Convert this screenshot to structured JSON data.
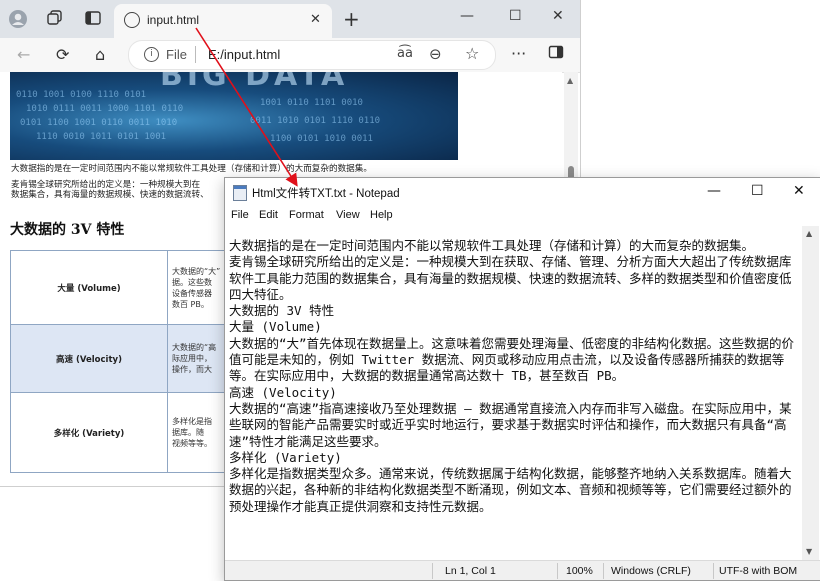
{
  "browser": {
    "tab_title": "input.html",
    "omnibox": {
      "scheme_label": "File",
      "url": "E:/input.html"
    }
  },
  "webpage": {
    "intro": "大数据指的是在一定时间范围内不能以常规软件工具处理（存储和计算）的大而复杂的数据集。",
    "def_line1": "麦肯锡全球研究所给出的定义是：一种规模大到在",
    "def_line2": "数据集合，具有海量的数据规模、快速的数据流转、",
    "section_title": "大数据的 3V 特性",
    "rows": [
      {
        "key": "大量 (Volume)",
        "lines": [
          "大数据的“大”",
          "据。这些数",
          "设备传感器",
          "数百 PB。"
        ]
      },
      {
        "key": "高速 (Velocity)",
        "lines": [
          "大数据的“高",
          "际应用中，",
          "操作，而大"
        ]
      },
      {
        "key": "多样化 (Variety)",
        "lines": [
          "多样化是指",
          "据库。随",
          "视频等等。"
        ]
      }
    ]
  },
  "notepad": {
    "title": "Html文件转TXT.txt - Notepad",
    "menu": [
      "File",
      "Edit",
      "Format",
      "View",
      "Help"
    ],
    "text": "大数据指的是在一定时间范围内不能以常规软件工具处理（存储和计算）的大而复杂的数据集。\n麦肯锡全球研究所给出的定义是：一种规模大到在获取、存储、管理、分析方面大大超出了传统数据库软件工具能力范围的数据集合，具有海量的数据规模、快速的数据流转、多样的数据类型和价值密度低四大特征。\n大数据的 3V 特性\n大量 (Volume)\n大数据的“大”首先体现在数据量上。这意味着您需要处理海量、低密度的非结构化数据。这些数据的价值可能是未知的，例如 Twitter 数据流、网页或移动应用点击流，以及设备传感器所捕获的数据等等。在实际应用中，大数据的数据量通常高达数十 TB，甚至数百 PB。\n高速 (Velocity)\n大数据的“高速”指高速接收乃至处理数据 — 数据通常直接流入内存而非写入磁盘。在实际应用中，某些联网的智能产品需要实时或近乎实时地运行，要求基于数据实时评估和操作，而大数据只有具备“高速”特性才能满足这些要求。\n多样化 (Variety)\n多样化是指数据类型众多。通常来说，传统数据属于结构化数据，能够整齐地纳入关系数据库。随着大数据的兴起，各种新的非结构化数据类型不断涌现，例如文本、音频和视频等等，它们需要经过额外的预处理操作才能真正提供洞察和支持性元数据。",
    "status": {
      "position": "Ln 1, Col 1",
      "zoom": "100%",
      "line_ending": "Windows (CRLF)",
      "encoding": "UTF-8 with BOM"
    }
  },
  "colors": {
    "arrow": "#e0101a",
    "table_border": "#8fa6c3",
    "table_alt_row": "#dde6f4"
  }
}
